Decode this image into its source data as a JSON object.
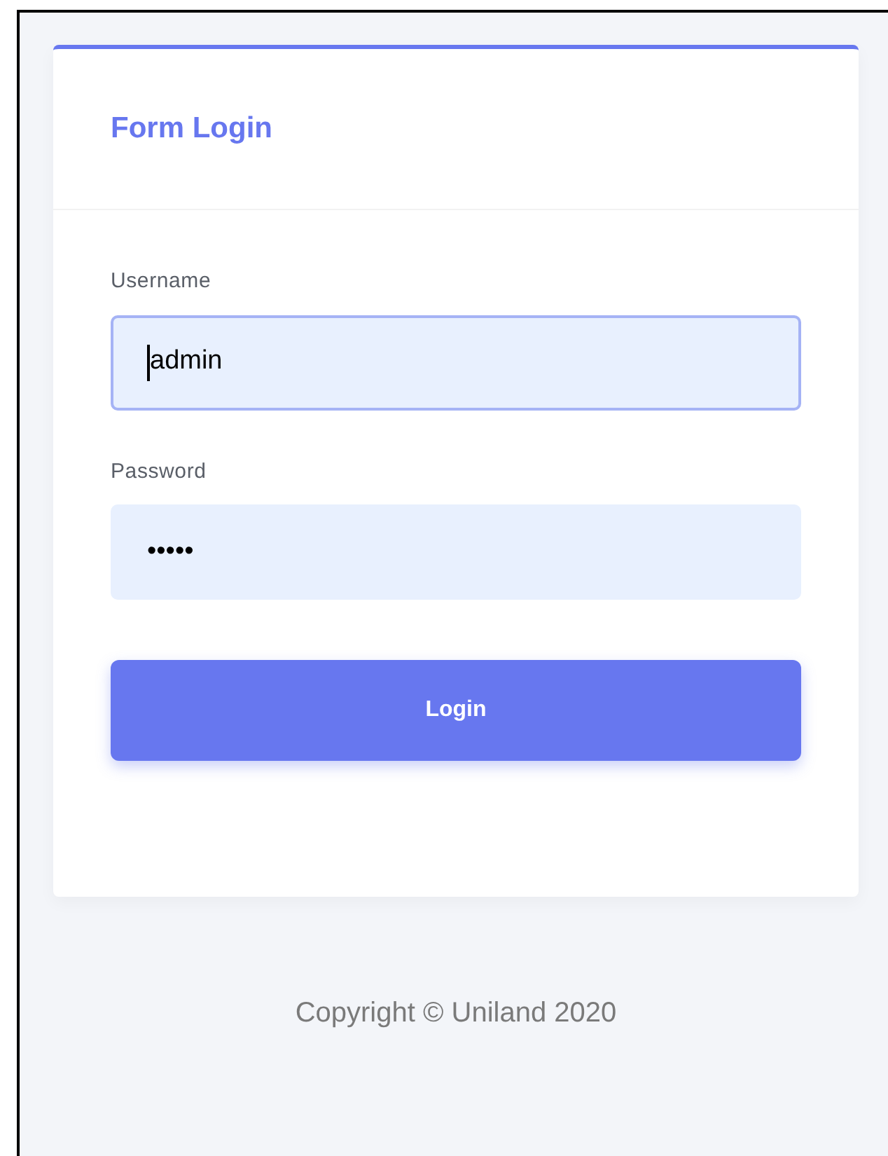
{
  "card": {
    "title": "Form Login"
  },
  "fields": [
    {
      "label": "Username",
      "value": "admin",
      "focused": true
    },
    {
      "label": "Password",
      "value": "•••••",
      "focused": false
    }
  ],
  "button": {
    "label": "Login"
  },
  "footer": {
    "text": "Copyright © Uniland 2020"
  }
}
